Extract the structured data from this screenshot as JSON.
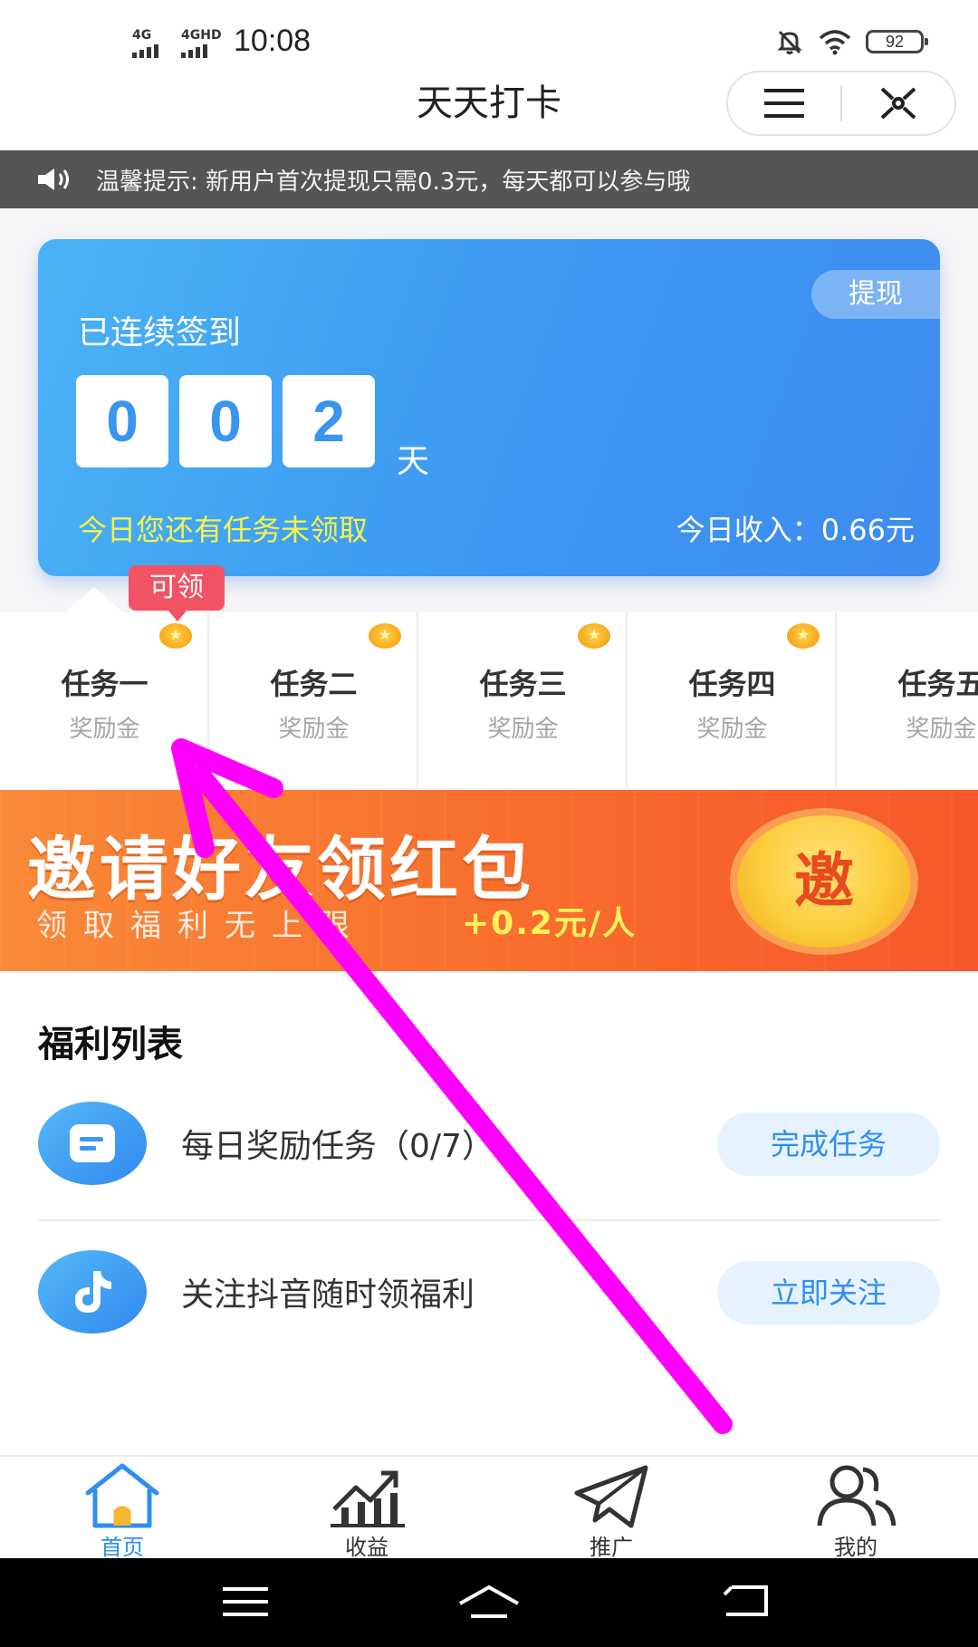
{
  "status_bar": {
    "signal_1": "4G",
    "signal_2": "4GHD",
    "time": "10:08",
    "battery": "92"
  },
  "header": {
    "title": "天天打卡",
    "menu_icon": "menu-icon",
    "close_icon": "close-icon"
  },
  "notice": {
    "icon": "speaker-icon",
    "text": "温馨提示: 新用户首次提现只需0.3元，每天都可以参与哦"
  },
  "card": {
    "withdraw_label": "提现",
    "streak_label": "已连续签到",
    "digits": [
      "0",
      "0",
      "2"
    ],
    "unit": "天",
    "pending_text": "今日您还有任务未领取",
    "income_text": "今日收入：0.66元"
  },
  "badge": "可领",
  "tasks": [
    {
      "name": "任务一",
      "sub": "奖励金"
    },
    {
      "name": "任务二",
      "sub": "奖励金"
    },
    {
      "name": "任务三",
      "sub": "奖励金"
    },
    {
      "name": "任务四",
      "sub": "奖励金"
    },
    {
      "name": "任务五",
      "sub": "奖励金"
    }
  ],
  "banner": {
    "headline": "邀请好友领红包",
    "subline": "领取福利无上限",
    "bonus": "+0.2元/人",
    "invite_label": "邀"
  },
  "welfare": {
    "title": "福利列表",
    "items": [
      {
        "icon": "document-icon",
        "label": "每日奖励任务（0/7）",
        "action": "完成任务"
      },
      {
        "icon": "tiktok-icon",
        "label": "关注抖音随时领福利",
        "action": "立即关注"
      }
    ]
  },
  "tabbar": {
    "items": [
      {
        "icon": "home-icon",
        "label": "首页",
        "active": true
      },
      {
        "icon": "chart-icon",
        "label": "收益",
        "active": false
      },
      {
        "icon": "send-icon",
        "label": "推广",
        "active": false
      },
      {
        "icon": "users-icon",
        "label": "我的",
        "active": false
      }
    ]
  },
  "colors": {
    "primary": "#3b97f1",
    "annotation_arrow": "#ff00ff",
    "badge": "#f25364",
    "banner": "#f86f2e"
  }
}
